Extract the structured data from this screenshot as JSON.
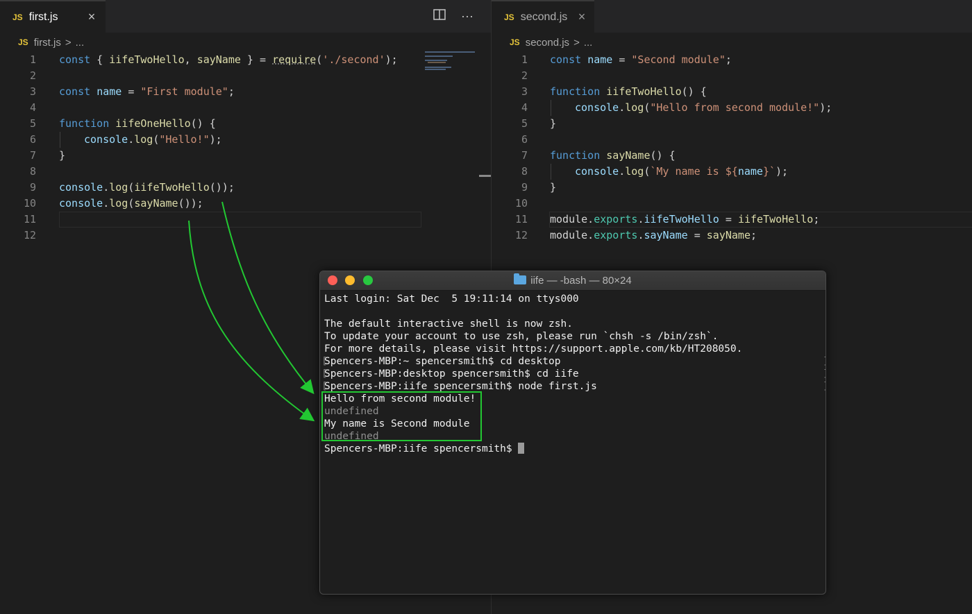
{
  "left_editor": {
    "tab": {
      "label": "first.js",
      "icon": "JS",
      "close": "×"
    },
    "actions": {
      "split": "split-editor-icon",
      "more": "···"
    },
    "breadcrumb": {
      "icon": "JS",
      "file": "first.js",
      "sep": ">",
      "rest": "..."
    },
    "line_numbers": [
      "1",
      "2",
      "3",
      "4",
      "5",
      "6",
      "7",
      "8",
      "9",
      "10",
      "11",
      "12"
    ]
  },
  "right_editor": {
    "tab": {
      "label": "second.js",
      "icon": "JS",
      "close": "×"
    },
    "breadcrumb": {
      "icon": "JS",
      "file": "second.js",
      "sep": ">",
      "rest": "..."
    },
    "line_numbers": [
      "1",
      "2",
      "3",
      "4",
      "5",
      "6",
      "7",
      "8",
      "9",
      "10",
      "11",
      "12"
    ]
  },
  "terminal": {
    "title": "iife — -bash — 80×24",
    "lines": [
      "Last login: Sat Dec  5 19:11:14 on ttys000",
      "",
      "The default interactive shell is now zsh.",
      "To update your account to use zsh, please run `chsh -s /bin/zsh`.",
      "For more details, please visit https://support.apple.com/kb/HT208050.",
      "Spencers-MBP:~ spencersmith$ cd desktop",
      "Spencers-MBP:desktop spencersmith$ cd iife",
      "Spencers-MBP:iife spencersmith$ node first.js",
      "Hello from second module!",
      "undefined",
      "My name is Second module",
      "undefined"
    ],
    "prompt": "Spencers-MBP:iife spencersmith$ "
  },
  "colors": {
    "keyword": "#569cd6",
    "function": "#dcdcaa",
    "string": "#ce9178",
    "variable": "#9cdcfe",
    "property": "#4ec9b0",
    "annotation": "#22c832",
    "traffic_close": "#fe5f57",
    "traffic_min": "#febc2e",
    "traffic_max": "#28c840"
  }
}
